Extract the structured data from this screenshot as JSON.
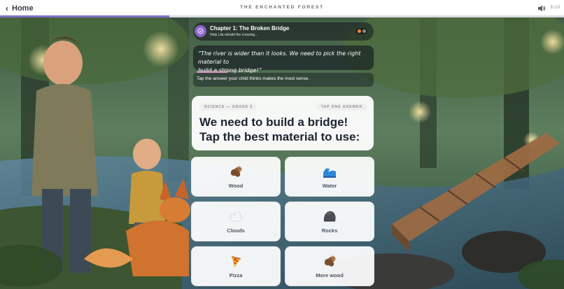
{
  "header": {
    "home_label": "Home",
    "app_title": "THE ENCHANTED FOREST",
    "counter": "3/10",
    "progress": 0.3
  },
  "chapter": {
    "title": "Chapter 1: The Broken Bridge",
    "subtitle": "Help Lila rebuild the crossing..."
  },
  "story": {
    "quote_line1": "“The river is wider than it looks. We need to pick the right material to",
    "quote_line2": "build a strong bridge!”",
    "hint": "Tap the answer your child thinks makes the most sense."
  },
  "question": {
    "subject_tag": "SCIENCE — GRADE 2",
    "instruction_tag": "TAP ONE ANSWER",
    "text": "We need to build a bridge! Tap the best material to use:"
  },
  "answers": [
    {
      "label": "Wood",
      "icon": "wood-log-icon"
    },
    {
      "label": "Water",
      "icon": "water-wave-icon"
    },
    {
      "label": "Clouds",
      "icon": "cloud-icon"
    },
    {
      "label": "Rocks",
      "icon": "rock-icon"
    },
    {
      "label": "Pizza",
      "icon": "pizza-icon"
    },
    {
      "label": "More wood",
      "icon": "wood-log-icon"
    }
  ],
  "colors": {
    "accent": "#7d72c7",
    "badge": "#8f63c9",
    "question_text": "#1d2533",
    "answer_text": "#4b5563"
  }
}
